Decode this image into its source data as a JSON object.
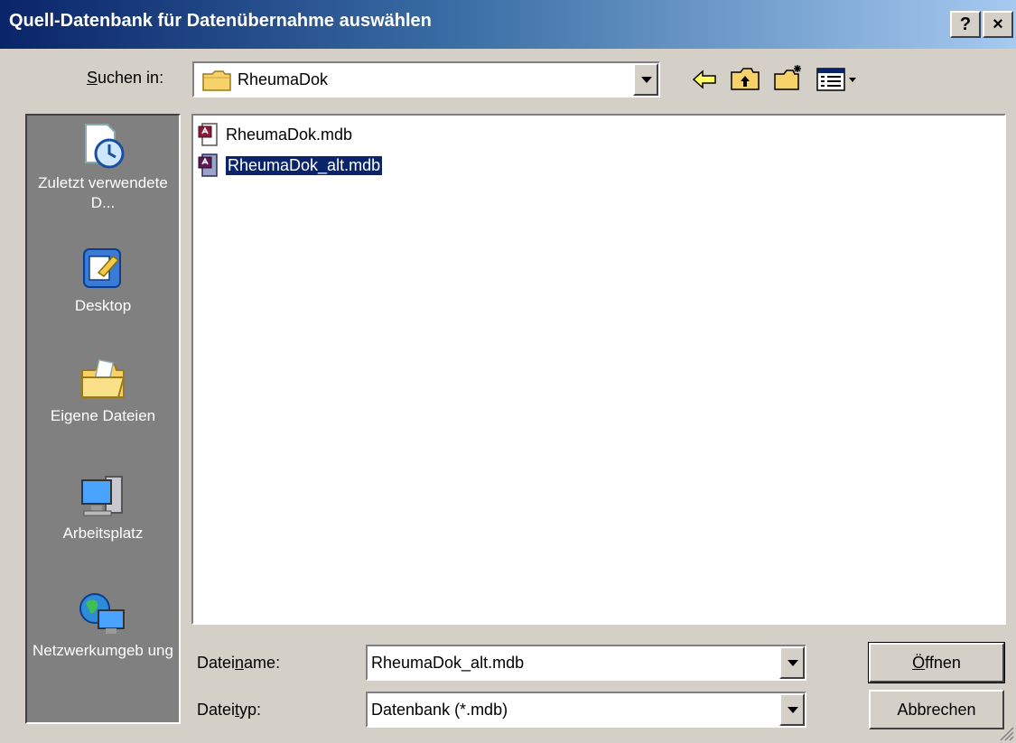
{
  "window": {
    "title": "Quell-Datenbank für Datenübernahme auswählen",
    "help_label": "?",
    "close_label": "×"
  },
  "lookin": {
    "label_pre": "",
    "label_accel": "S",
    "label_post": "uchen in:",
    "value": "RheumaDok"
  },
  "places": [
    {
      "label": "Zuletzt verwendete D...",
      "icon": "recent-documents-icon"
    },
    {
      "label": "Desktop",
      "icon": "desktop-icon"
    },
    {
      "label": "Eigene Dateien",
      "icon": "my-documents-icon"
    },
    {
      "label": "Arbeitsplatz",
      "icon": "my-computer-icon"
    },
    {
      "label": "Netzwerkumgeb ung",
      "icon": "network-icon"
    }
  ],
  "files": [
    {
      "name": "RheumaDok.mdb",
      "selected": false
    },
    {
      "name": "RheumaDok_alt.mdb",
      "selected": true
    }
  ],
  "filename": {
    "label_pre": "Datei",
    "label_accel": "n",
    "label_post": "ame:",
    "value": "RheumaDok_alt.mdb"
  },
  "filetype": {
    "label_pre": "Datei",
    "label_accel": "t",
    "label_post": "yp:",
    "value": "Datenbank (*.mdb)"
  },
  "buttons": {
    "open_pre": "",
    "open_accel": "Ö",
    "open_post": "ffnen",
    "cancel": "Abbrechen"
  },
  "colors": {
    "title_start": "#0a246a",
    "title_end": "#a6caf0",
    "face": "#d4d0c8",
    "places_bg": "#808080",
    "selection": "#0a246a"
  }
}
